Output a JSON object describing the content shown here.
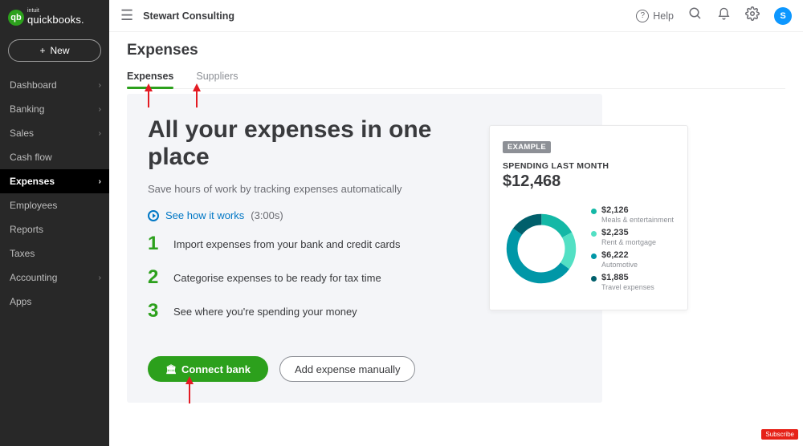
{
  "brand": {
    "intuit": "intuit",
    "name": "quickbooks.",
    "badge": "qb"
  },
  "topbar": {
    "company": "Stewart Consulting",
    "help_label": "Help",
    "avatar_initial": "S"
  },
  "sidebar": {
    "new_label": "New",
    "items": [
      {
        "label": "Dashboard",
        "hasChevron": true
      },
      {
        "label": "Banking",
        "hasChevron": true
      },
      {
        "label": "Sales",
        "hasChevron": true
      },
      {
        "label": "Cash flow",
        "hasChevron": false
      },
      {
        "label": "Expenses",
        "hasChevron": true,
        "active": true
      },
      {
        "label": "Employees",
        "hasChevron": false
      },
      {
        "label": "Reports",
        "hasChevron": false
      },
      {
        "label": "Taxes",
        "hasChevron": false
      },
      {
        "label": "Accounting",
        "hasChevron": true
      },
      {
        "label": "Apps",
        "hasChevron": false
      }
    ]
  },
  "page": {
    "title": "Expenses",
    "tabs": [
      {
        "label": "Expenses",
        "active": true
      },
      {
        "label": "Suppliers",
        "active": false
      }
    ]
  },
  "hero": {
    "headline": "All your expenses in one place",
    "sub": "Save hours of work by tracking expenses automatically",
    "see_how": "See how it works",
    "duration": "(3:00s)",
    "steps": [
      "Import expenses from your bank and credit cards",
      "Categorise expenses to be ready for tax time",
      "See where you're spending your money"
    ],
    "cta_primary": "Connect bank",
    "cta_secondary": "Add expense manually"
  },
  "card": {
    "badge": "EXAMPLE",
    "label": "SPENDING LAST MONTH",
    "value": "$12,468",
    "legend": [
      {
        "value": "$2,126",
        "caption": "Meals & entertainment",
        "color": "#14b8a6"
      },
      {
        "value": "$2,235",
        "caption": "Rent & mortgage",
        "color": "#53e0c4"
      },
      {
        "value": "$6,222",
        "caption": "Automotive",
        "color": "#0097a7"
      },
      {
        "value": "$1,885",
        "caption": "Travel expenses",
        "color": "#005f6b"
      }
    ]
  },
  "chart_data": {
    "type": "pie",
    "title": "Spending last month",
    "total_label": "$12,468",
    "categories": [
      "Meals & entertainment",
      "Rent & mortgage",
      "Automotive",
      "Travel expenses"
    ],
    "values": [
      2126,
      2235,
      6222,
      1885
    ],
    "colors": [
      "#14b8a6",
      "#53e0c4",
      "#0097a7",
      "#005f6b"
    ]
  },
  "subscribe_label": "Subscribe"
}
